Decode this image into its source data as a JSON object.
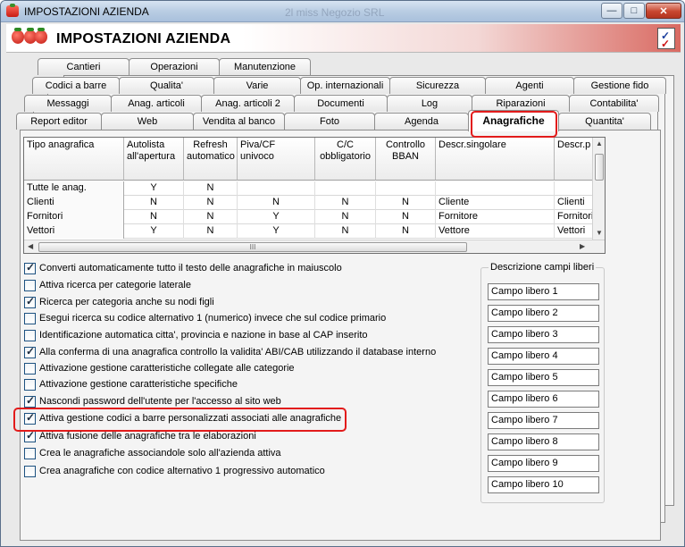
{
  "window": {
    "title": "IMPOSTAZIONI AZIENDA",
    "background_title": "2l miss Negozio SRL",
    "controls": {
      "minimize": "—",
      "maximize": "□",
      "close": "✕"
    }
  },
  "header": {
    "title": "IMPOSTAZIONI AZIENDA",
    "icons": [
      "strawberries-logo",
      "checklist-icon"
    ]
  },
  "tabs": {
    "row1": [
      "Cantieri",
      "Operazioni",
      "Manutenzione"
    ],
    "row2": [
      "Codici a barre",
      "Qualita'",
      "Varie",
      "Op. internazionali",
      "Sicurezza",
      "Agenti",
      "Gestione fido"
    ],
    "row3": [
      "Messaggi",
      "Anag. articoli",
      "Anag. articoli 2",
      "Documenti",
      "Log",
      "Riparazioni",
      "Contabilita'"
    ],
    "row4": [
      "Report editor",
      "Web",
      "Vendita al banco",
      "Foto",
      "Agenda",
      "Anagrafiche",
      "Quantita'"
    ],
    "active": "Anagrafiche"
  },
  "grid": {
    "columns": [
      "Tipo anagrafica",
      "Autolista all'apertura",
      "Refresh automatico",
      "Piva/CF univoco",
      "C/C obbligatorio",
      "Controllo BBAN",
      "Descr.singolare",
      "Descr.p"
    ],
    "rows": [
      [
        "Tutte le anag.",
        "Y",
        "N",
        "",
        "",
        "",
        "",
        ""
      ],
      [
        "Clienti",
        "N",
        "N",
        "N",
        "N",
        "N",
        "Cliente",
        "Clienti"
      ],
      [
        "Fornitori",
        "N",
        "N",
        "Y",
        "N",
        "N",
        "Fornitore",
        "Fornitori"
      ],
      [
        "Vettori",
        "Y",
        "N",
        "Y",
        "N",
        "N",
        "Vettore",
        "Vettori"
      ]
    ],
    "scroll_grip": "III"
  },
  "options": [
    {
      "label": "Converti automaticamente tutto il testo delle anagrafiche in maiuscolo",
      "checked": true
    },
    {
      "label": "Attiva ricerca per categorie laterale",
      "checked": false
    },
    {
      "label": "Ricerca per categoria anche su nodi figli",
      "checked": true
    },
    {
      "label": "Esegui ricerca su codice alternativo 1 (numerico) invece che sul codice primario",
      "checked": false
    },
    {
      "label": "Identificazione automatica citta', provincia e nazione in base al CAP inserito",
      "checked": false
    },
    {
      "label": "Alla conferma di una anagrafica controllo la validita' ABI/CAB utilizzando il database interno",
      "checked": true
    },
    {
      "label": "Attivazione gestione caratteristiche collegate alle categorie",
      "checked": false
    },
    {
      "label": "Attivazione gestione caratteristiche specifiche",
      "checked": false
    },
    {
      "label": "Nascondi password dell'utente per l'accesso al sito web",
      "checked": true
    },
    {
      "label": "Attiva gestione codici a barre personalizzati associati alle anagrafiche",
      "checked": true
    },
    {
      "label": "Attiva fusione delle anagrafiche tra le elaborazioni",
      "checked": true
    },
    {
      "label": "Crea le anagrafiche associandole solo all'azienda attiva",
      "checked": false
    },
    {
      "label": "Crea anagrafiche con codice alternativo 1 progressivo automatico",
      "checked": false
    }
  ],
  "free_fields": {
    "title": "Descrizione campi liberi",
    "fields": [
      "Campo libero 1",
      "Campo libero 2",
      "Campo libero 3",
      "Campo libero 4",
      "Campo libero 5",
      "Campo libero 6",
      "Campo libero 7",
      "Campo libero 8",
      "Campo libero 9",
      "Campo libero 10"
    ]
  },
  "colors": {
    "highlight": "#e21b1b"
  }
}
